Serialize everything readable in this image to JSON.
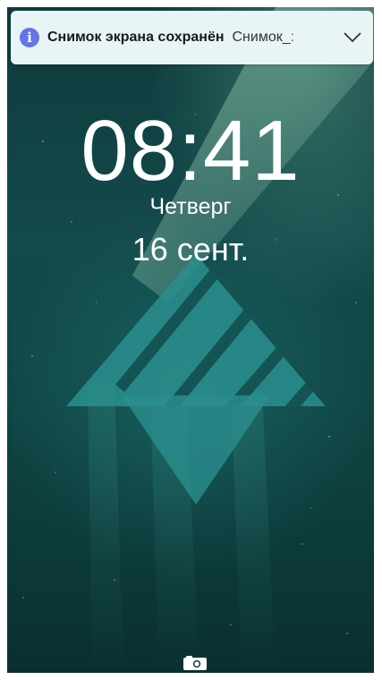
{
  "notification": {
    "icon": "info-icon",
    "icon_glyph": "i",
    "icon_color": "#6574e6",
    "title": "Снимок экрана сохранён",
    "body": "Снимок_:",
    "chevron": "chevron-down-icon"
  },
  "lockscreen": {
    "time": "08:41",
    "weekday": "Четверг",
    "date": "16 сент."
  },
  "quick_actions": {
    "camera": "camera-icon"
  },
  "colors": {
    "wallpaper": "#134a4b",
    "logo": "#2a8f8e"
  }
}
